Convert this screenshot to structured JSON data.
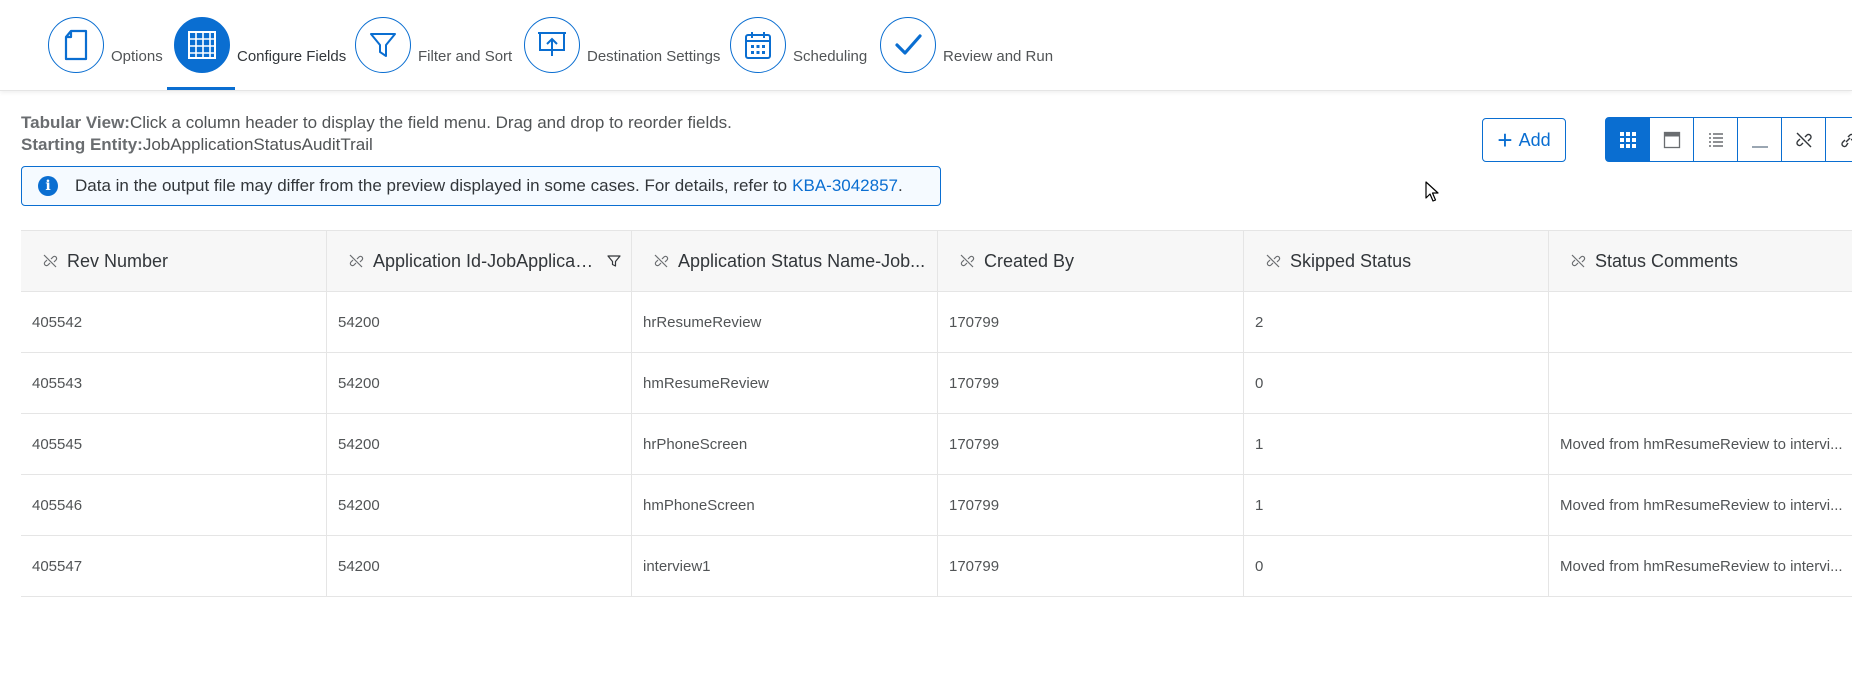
{
  "wizard": {
    "steps": [
      {
        "label": "Options",
        "icon": "document-icon",
        "active": false
      },
      {
        "label": "Configure Fields",
        "icon": "table-grid-icon",
        "active": true
      },
      {
        "label": "Filter and Sort",
        "icon": "filter-icon",
        "active": false
      },
      {
        "label": "Destination Settings",
        "icon": "upload-screen-icon",
        "active": false
      },
      {
        "label": "Scheduling",
        "icon": "calendar-icon",
        "active": false
      },
      {
        "label": "Review and Run",
        "icon": "checkmark-icon",
        "active": false
      }
    ]
  },
  "info": {
    "view_label": "Tabular View:",
    "view_text": "Click a column header to display the field menu. Drag and drop to reorder fields.",
    "entity_label": "Starting Entity:",
    "entity_text": "JobApplicationStatusAuditTrail"
  },
  "message": {
    "text": "Data in the output file may differ from the preview displayed in some cases. For details, refer to",
    "link": "KBA-3042857",
    "suffix": "."
  },
  "toolbar": {
    "add_label": "Add",
    "view_buttons": [
      "grid-view-icon",
      "panel-view-icon",
      "list-view-icon",
      "minimize-icon",
      "unlink-icon",
      "link-icon"
    ],
    "selected_view": "grid-view-icon"
  },
  "table": {
    "columns": [
      {
        "label": "Rev Number",
        "filtered": false
      },
      {
        "label": "Application Id-JobApplicati...",
        "filtered": true
      },
      {
        "label": "Application Status Name-Job...",
        "filtered": false
      },
      {
        "label": "Created By",
        "filtered": false
      },
      {
        "label": "Skipped Status",
        "filtered": false
      },
      {
        "label": "Status Comments",
        "filtered": false
      }
    ],
    "rows": [
      [
        "405542",
        "54200",
        "hrResumeReview",
        "170799",
        "2",
        ""
      ],
      [
        "405543",
        "54200",
        "hmResumeReview",
        "170799",
        "0",
        ""
      ],
      [
        "405545",
        "54200",
        "hrPhoneScreen",
        "170799",
        "1",
        "Moved from hmResumeReview to intervi..."
      ],
      [
        "405546",
        "54200",
        "hmPhoneScreen",
        "170799",
        "1",
        "Moved from hmResumeReview to intervi..."
      ],
      [
        "405547",
        "54200",
        "interview1",
        "170799",
        "0",
        "Moved from hmResumeReview to intervi..."
      ]
    ]
  },
  "colors": {
    "accent": "#0a6ed1",
    "text": "#32363a",
    "muted": "#515456",
    "border": "#e5e5e5"
  }
}
